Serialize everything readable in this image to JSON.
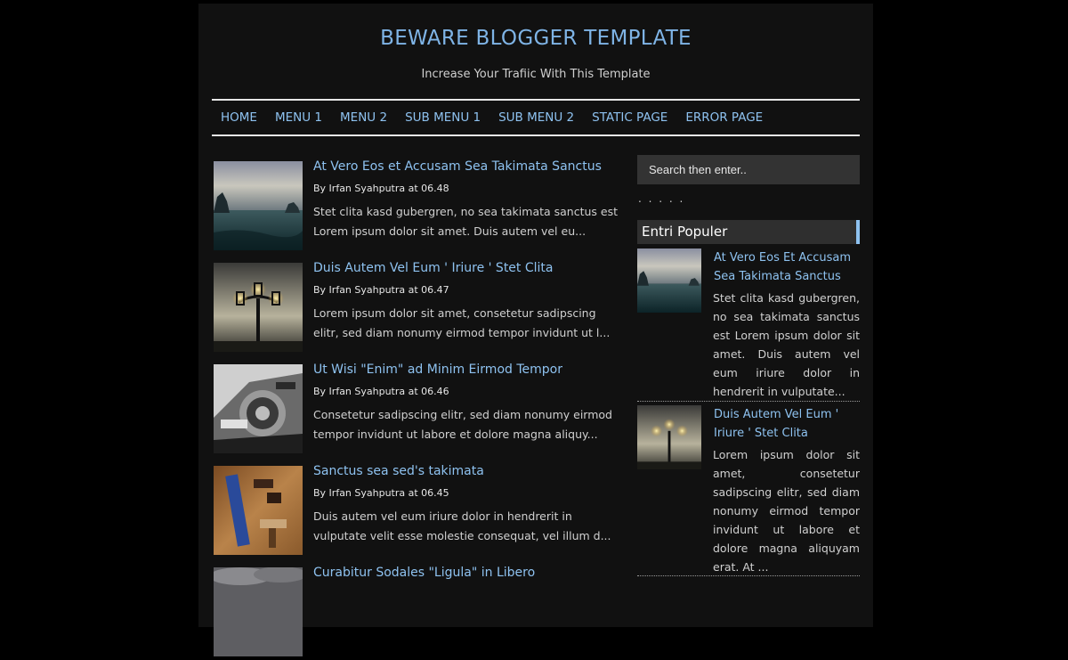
{
  "header": {
    "title": "BEWARE BLOGGER TEMPLATE",
    "description": "Increase Your Trafiic With This Template"
  },
  "nav": {
    "items": [
      "HOME",
      "MENU 1",
      "MENU 2",
      "SUB MENU 1",
      "SUB MENU 2",
      "STATIC PAGE",
      "ERROR PAGE"
    ]
  },
  "posts": [
    {
      "title": "At Vero Eos et Accusam Sea Takimata Sanctus",
      "meta": "By Irfan Syahputra at 06.48",
      "snippet": "Stet clita kasd gubergren, no sea takimata sanctus est Lorem ipsum dolor sit amet. Duis autem vel eu...",
      "thumb": "sea-rocks-image"
    },
    {
      "title": "Duis Autem Vel Eum ' Iriure ' Stet Clita",
      "meta": "By Irfan Syahputra at 06.47",
      "snippet": "Lorem ipsum dolor sit amet, consetetur sadipscing elitr, sed diam nonumy eirmod tempor invidunt ut l...",
      "thumb": "street-lamp-image"
    },
    {
      "title": "Ut Wisi \"Enim\" ad Minim Eirmod Tempor",
      "meta": "By Irfan Syahputra at 06.46",
      "snippet": "Consetetur sadipscing elitr, sed diam nonumy eirmod tempor invidunt ut labore et dolore magna aliquy...",
      "thumb": "machinery-image"
    },
    {
      "title": "Sanctus sea sed's takimata",
      "meta": "By Irfan Syahputra at 06.45",
      "snippet": "Duis autem vel eum iriure dolor in hendrerit in vulputate velit esse molestie consequat, vel illum d...",
      "thumb": "wood-tools-image"
    },
    {
      "title": "Curabitur Sodales \"Ligula\" in Libero",
      "meta": "",
      "snippet": "",
      "thumb": "cloudy-sky-image"
    }
  ],
  "sidebar": {
    "search_placeholder": "Search then enter..",
    "dots": ". . . . .",
    "popular_heading": "Entri Populer",
    "popular": [
      {
        "title": "At Vero Eos Et Accusam Sea Takimata Sanctus",
        "snippet": "Stet clita kasd gubergren, no sea takimata sanctus est Lorem ipsum dolor sit amet. Duis autem vel eum iriure dolor in hendrerit in vulputate..."
      },
      {
        "title": "Duis Autem Vel Eum ' Iriure ' Stet Clita",
        "snippet": "Lorem ipsum dolor sit amet, consetetur sadipscing elitr, sed diam nonumy eirmod tempor invidunt ut labore et dolore magna aliquyam erat. At ..."
      }
    ]
  },
  "colors": {
    "background": "#000000",
    "page": "#111111",
    "accent": "#8ec2f0",
    "title": "#7fb4e6",
    "text": "#d0d0d0"
  }
}
